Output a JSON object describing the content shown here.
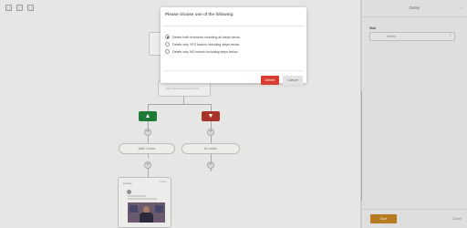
{
  "modal": {
    "title": "Please choose one of the following:",
    "options": [
      {
        "label": "Delete both branches including all steps below.",
        "selected": true
      },
      {
        "label": "Delete only YES branch including steps below.",
        "selected": false
      },
      {
        "label": "Delete only NO branch including steps below.",
        "selected": false
      }
    ],
    "delete_label": "Delete",
    "cancel_label": "Cancel",
    "colors": {
      "delete": "#d83c2e"
    }
  },
  "canvas": {
    "link_text": "Mohr dummee Fenstzie Mi...",
    "branch_yes_icon": "thumbs-up-icon",
    "branch_no_icon": "thumbs-down-icon",
    "wait_pill_label": "Wait 1 hours",
    "no_action_pill_label": "No action",
    "email_preview": {
      "from": "Limbuy",
      "ago": "Delay"
    }
  },
  "panel": {
    "title": "Delay",
    "close_label": "×",
    "field_label": "Wait",
    "select_value": "Weeks",
    "save_label": "Save",
    "cancel_label": "Cancel",
    "colors": {
      "save": "#b77a22"
    }
  }
}
